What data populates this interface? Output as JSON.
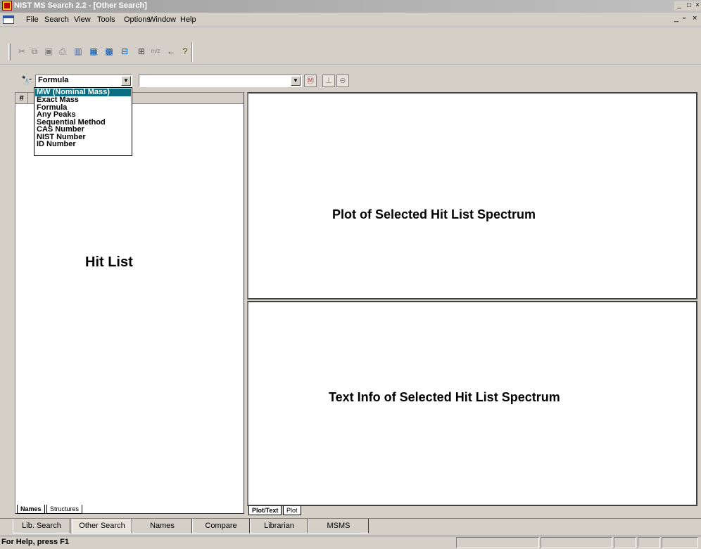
{
  "window": {
    "title": "NIST MS Search 2.2 - [Other Search]"
  },
  "menu": [
    "File",
    "Search",
    "View",
    "Tools",
    "Options",
    "Window",
    "Help"
  ],
  "toolbar": {
    "icons": [
      "cut-icon",
      "copy-icon",
      "paste-icon",
      "print-icon",
      "chart-icon",
      "library-icon",
      "ms-icon",
      "compare-icon",
      "grid-icon",
      "mz-icon",
      "back-arrow-icon",
      "help-icon"
    ],
    "mz_label": "m/z"
  },
  "search": {
    "type_value": "Formula",
    "input_value": "",
    "options": [
      "MW (Nominal Mass)",
      "Exact Mass",
      "Formula",
      "Any Peaks",
      "Sequential Method",
      "CAS Number",
      "NIST Number",
      "ID Number"
    ],
    "highlighted_index": 0
  },
  "hitlist": {
    "col_hash": "#",
    "label": "Hit List",
    "tabs": [
      "Names",
      "Structures"
    ]
  },
  "plot": {
    "label": "Plot of Selected Hit List Spectrum"
  },
  "info": {
    "label": "Text Info of Selected Hit List Spectrum",
    "tabs": [
      "Plot/Text",
      "Plot"
    ]
  },
  "bottom_tabs": [
    "Lib. Search",
    "Other Search",
    "Names",
    "Compare",
    "Librarian",
    "MSMS"
  ],
  "active_bottom_tab": "Other Search",
  "status": {
    "text": "For Help, press F1"
  }
}
